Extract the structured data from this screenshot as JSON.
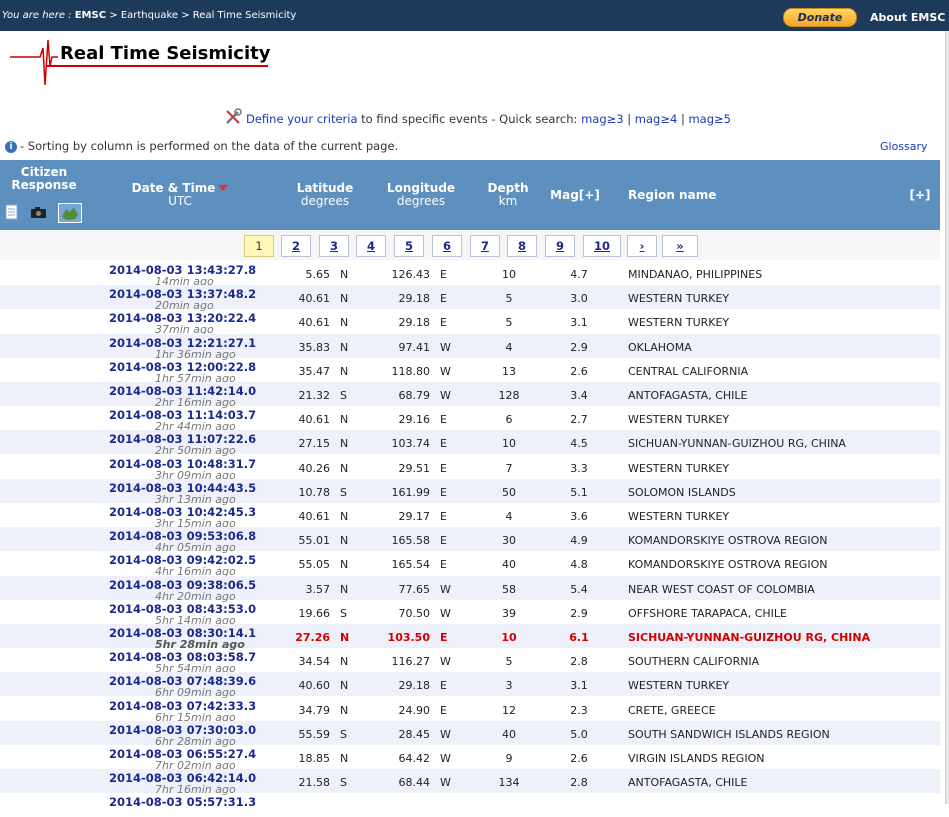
{
  "breadcrumb": {
    "prefix": "You are here :",
    "home": "EMSC",
    "sep": ">",
    "level1": "Earthquake",
    "level2": "Real Time Seismicity"
  },
  "top_actions": {
    "donate": "Donate",
    "about": "About EMSC"
  },
  "page_title": "Real Time Seismicity",
  "criteria": {
    "link": "Define your criteria",
    "text": "to find specific events - Quick search:",
    "mag3": "mag≥3",
    "mag4": "mag≥4",
    "mag5": "mag≥5",
    "sep": "|"
  },
  "note": "- Sorting by column is performed on the data of the current page.",
  "glossary": "Glossary",
  "columns": {
    "citizen": "Citizen Response",
    "datetime": "Date & Time",
    "datetime_sub": "UTC",
    "latitude": "Latitude",
    "latitude_sub": "degrees",
    "longitude": "Longitude",
    "longitude_sub": "degrees",
    "depth": "Depth",
    "depth_sub": "km",
    "mag": "Mag[+]",
    "region": "Region name",
    "expand": "[+]"
  },
  "pagination": [
    "1",
    "2",
    "3",
    "4",
    "5",
    "6",
    "7",
    "8",
    "9",
    "10",
    "›",
    "»"
  ],
  "events": [
    {
      "dt": "2014-08-03   13:43:27.8",
      "ago": "14min ago",
      "lat": "5.65",
      "ns": "N",
      "lon": "126.43",
      "ew": "E",
      "depth": "10",
      "mag": "4.7",
      "region": "MINDANAO, PHILIPPINES"
    },
    {
      "dt": "2014-08-03   13:37:48.2",
      "ago": "20min ago",
      "lat": "40.61",
      "ns": "N",
      "lon": "29.18",
      "ew": "E",
      "depth": "5",
      "mag": "3.0",
      "region": "WESTERN TURKEY"
    },
    {
      "dt": "2014-08-03   13:20:22.4",
      "ago": "37min ago",
      "lat": "40.61",
      "ns": "N",
      "lon": "29.18",
      "ew": "E",
      "depth": "5",
      "mag": "3.1",
      "region": "WESTERN TURKEY"
    },
    {
      "dt": "2014-08-03   12:21:27.1",
      "ago": "1hr 36min ago",
      "lat": "35.83",
      "ns": "N",
      "lon": "97.41",
      "ew": "W",
      "depth": "4",
      "mag": "2.9",
      "region": "OKLAHOMA"
    },
    {
      "dt": "2014-08-03   12:00:22.8",
      "ago": "1hr 57min ago",
      "lat": "35.47",
      "ns": "N",
      "lon": "118.80",
      "ew": "W",
      "depth": "13",
      "mag": "2.6",
      "region": "CENTRAL CALIFORNIA"
    },
    {
      "dt": "2014-08-03   11:42:14.0",
      "ago": "2hr 16min ago",
      "lat": "21.32",
      "ns": "S",
      "lon": "68.79",
      "ew": "W",
      "depth": "128",
      "mag": "3.4",
      "region": "ANTOFAGASTA, CHILE"
    },
    {
      "dt": "2014-08-03   11:14:03.7",
      "ago": "2hr 44min ago",
      "lat": "40.61",
      "ns": "N",
      "lon": "29.16",
      "ew": "E",
      "depth": "6",
      "mag": "2.7",
      "region": "WESTERN TURKEY"
    },
    {
      "dt": "2014-08-03   11:07:22.6",
      "ago": "2hr 50min ago",
      "lat": "27.15",
      "ns": "N",
      "lon": "103.74",
      "ew": "E",
      "depth": "10",
      "mag": "4.5",
      "region": "SICHUAN-YUNNAN-GUIZHOU RG, CHINA"
    },
    {
      "dt": "2014-08-03   10:48:31.7",
      "ago": "3hr 09min ago",
      "lat": "40.26",
      "ns": "N",
      "lon": "29.51",
      "ew": "E",
      "depth": "7",
      "mag": "3.3",
      "region": "WESTERN TURKEY"
    },
    {
      "dt": "2014-08-03   10:44:43.5",
      "ago": "3hr 13min ago",
      "lat": "10.78",
      "ns": "S",
      "lon": "161.99",
      "ew": "E",
      "depth": "50",
      "mag": "5.1",
      "region": "SOLOMON ISLANDS"
    },
    {
      "dt": "2014-08-03   10:42:45.3",
      "ago": "3hr 15min ago",
      "lat": "40.61",
      "ns": "N",
      "lon": "29.17",
      "ew": "E",
      "depth": "4",
      "mag": "3.6",
      "region": "WESTERN TURKEY"
    },
    {
      "dt": "2014-08-03   09:53:06.8",
      "ago": "4hr 05min ago",
      "lat": "55.01",
      "ns": "N",
      "lon": "165.58",
      "ew": "E",
      "depth": "30",
      "mag": "4.9",
      "region": "KOMANDORSKIYE OSTROVA REGION"
    },
    {
      "dt": "2014-08-03   09:42:02.5",
      "ago": "4hr 16min ago",
      "lat": "55.05",
      "ns": "N",
      "lon": "165.54",
      "ew": "E",
      "depth": "40",
      "mag": "4.8",
      "region": "KOMANDORSKIYE OSTROVA REGION"
    },
    {
      "dt": "2014-08-03   09:38:06.5",
      "ago": "4hr 20min ago",
      "lat": "3.57",
      "ns": "N",
      "lon": "77.65",
      "ew": "W",
      "depth": "58",
      "mag": "5.4",
      "region": "NEAR WEST COAST OF COLOMBIA"
    },
    {
      "dt": "2014-08-03   08:43:53.0",
      "ago": "5hr 14min ago",
      "lat": "19.66",
      "ns": "S",
      "lon": "70.50",
      "ew": "W",
      "depth": "39",
      "mag": "2.9",
      "region": "OFFSHORE TARAPACA, CHILE"
    },
    {
      "dt": "2014-08-03   08:30:14.1",
      "ago": "5hr 28min ago",
      "lat": "27.26",
      "ns": "N",
      "lon": "103.50",
      "ew": "E",
      "depth": "10",
      "mag": "6.1",
      "region": "SICHUAN-YUNNAN-GUIZHOU RG, CHINA",
      "highlight": true
    },
    {
      "dt": "2014-08-03   08:03:58.7",
      "ago": "5hr 54min ago",
      "lat": "34.54",
      "ns": "N",
      "lon": "116.27",
      "ew": "W",
      "depth": "5",
      "mag": "2.8",
      "region": "SOUTHERN CALIFORNIA"
    },
    {
      "dt": "2014-08-03   07:48:39.6",
      "ago": "6hr 09min ago",
      "lat": "40.60",
      "ns": "N",
      "lon": "29.18",
      "ew": "E",
      "depth": "3",
      "mag": "3.1",
      "region": "WESTERN TURKEY"
    },
    {
      "dt": "2014-08-03   07:42:33.3",
      "ago": "6hr 15min ago",
      "lat": "34.79",
      "ns": "N",
      "lon": "24.90",
      "ew": "E",
      "depth": "12",
      "mag": "2.3",
      "region": "CRETE, GREECE"
    },
    {
      "dt": "2014-08-03   07:30:03.0",
      "ago": "6hr 28min ago",
      "lat": "55.59",
      "ns": "S",
      "lon": "28.45",
      "ew": "W",
      "depth": "40",
      "mag": "5.0",
      "region": "SOUTH SANDWICH ISLANDS REGION"
    },
    {
      "dt": "2014-08-03   06:55:27.4",
      "ago": "7hr 02min ago",
      "lat": "18.85",
      "ns": "N",
      "lon": "64.42",
      "ew": "W",
      "depth": "9",
      "mag": "2.6",
      "region": "VIRGIN ISLANDS REGION"
    },
    {
      "dt": "2014-08-03   06:42:14.0",
      "ago": "7hr 16min ago",
      "lat": "21.58",
      "ns": "S",
      "lon": "68.44",
      "ew": "W",
      "depth": "134",
      "mag": "2.8",
      "region": "ANTOFAGASTA, CHILE"
    },
    {
      "dt": "2014-08-03   05:57:31.3",
      "ago": "",
      "lat": "",
      "ns": "",
      "lon": "",
      "ew": "",
      "depth": "",
      "mag": "",
      "region": ""
    }
  ]
}
